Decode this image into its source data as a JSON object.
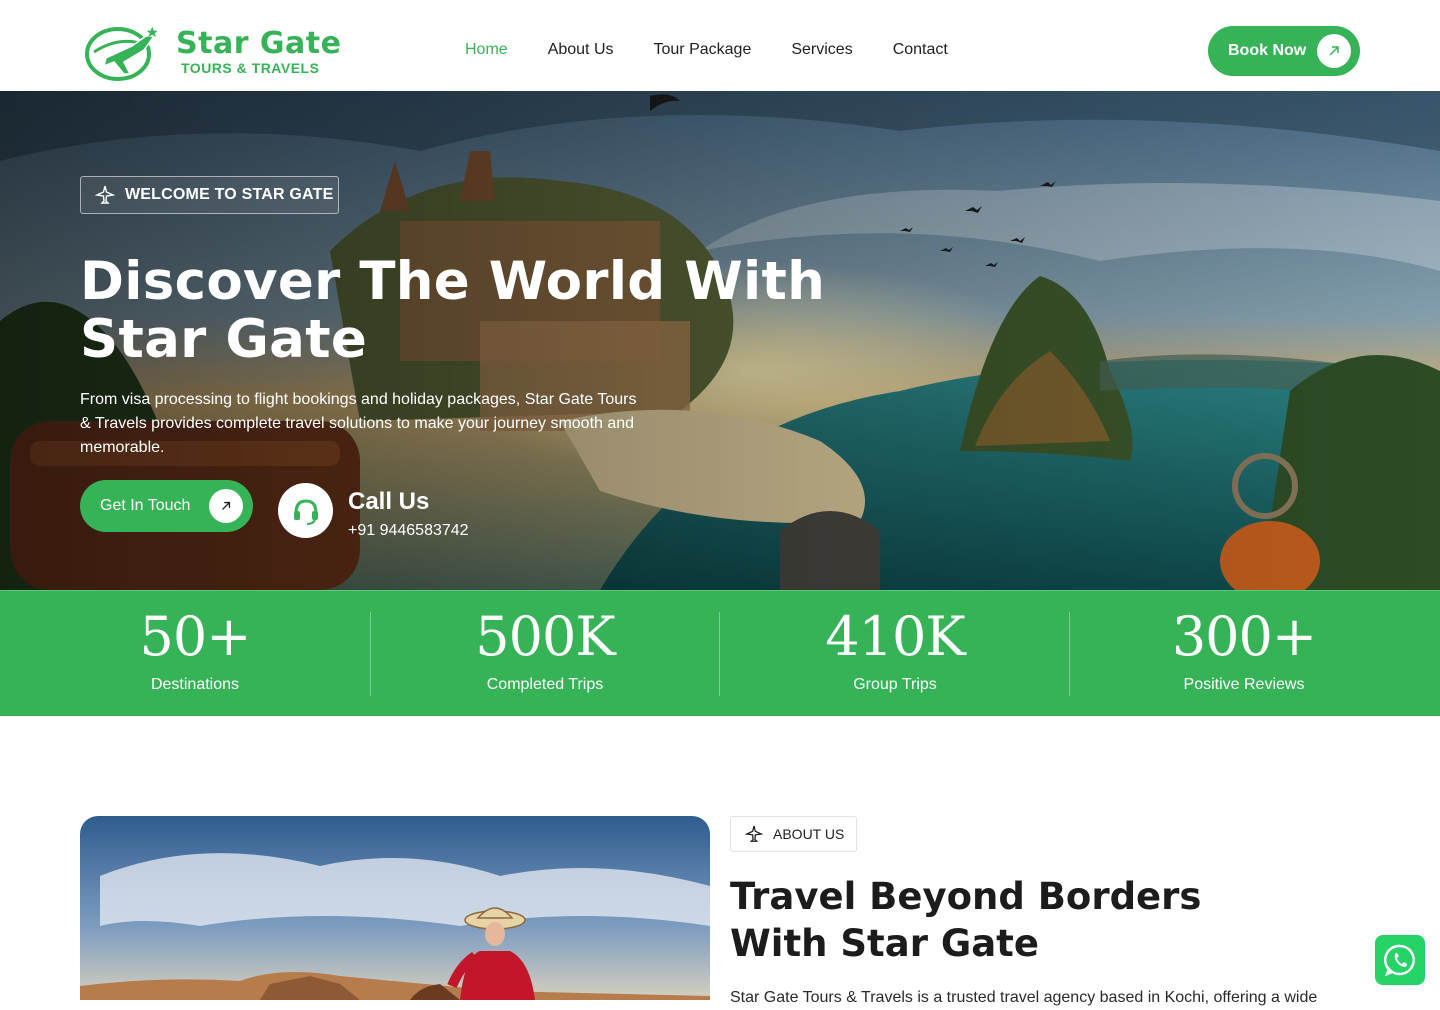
{
  "brand": {
    "name": "Star Gate",
    "tagline": "TOURS & TRAVELS"
  },
  "nav": {
    "items": [
      {
        "label": "Home",
        "active": true
      },
      {
        "label": "About Us",
        "active": false
      },
      {
        "label": "Tour Package",
        "active": false
      },
      {
        "label": "Services",
        "active": false
      },
      {
        "label": "Contact",
        "active": false
      }
    ],
    "book_label": "Book Now"
  },
  "hero": {
    "badge": "WELCOME TO STAR GATE",
    "title": "Discover The World With Star Gate",
    "description": "From visa processing to flight bookings and holiday packages, Star Gate Tours & Travels provides complete travel solutions to make your journey smooth and memorable.",
    "cta_label": "Get In Touch",
    "call_title": "Call Us",
    "call_number": "+91 9446583742"
  },
  "stats": [
    {
      "value": "50+",
      "label": "Destinations"
    },
    {
      "value": "500K",
      "label": "Completed Trips"
    },
    {
      "value": "410K",
      "label": "Group Trips"
    },
    {
      "value": "300+",
      "label": "Positive Reviews"
    }
  ],
  "about": {
    "badge": "ABOUT US",
    "title": "Travel Beyond Borders With Star Gate",
    "description": "Star Gate Tours & Travels is a trusted travel agency based in Kochi, offering a wide"
  },
  "colors": {
    "accent": "#36b357",
    "text_dark": "#1c1c1c",
    "whatsapp": "#25d366"
  },
  "icons": {
    "logo": "plane-globe-logo",
    "badge": "airplane-icon",
    "arrow": "arrow-up-right-icon",
    "call": "headset-icon",
    "chat": "whatsapp-icon"
  }
}
